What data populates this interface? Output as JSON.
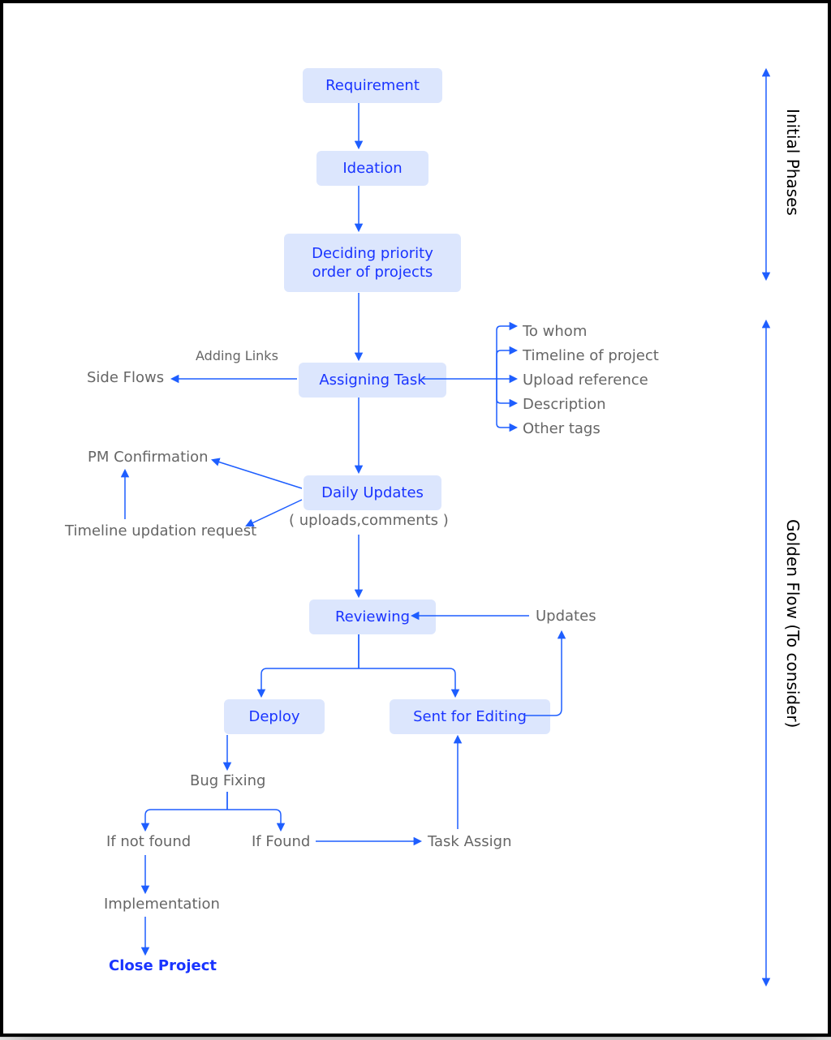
{
  "colors": {
    "box_bg": "#DCE6FD",
    "box_text": "#1934FF",
    "line": "#1E5EFF",
    "plain_text": "#666666",
    "bold_blue": "#1934FF"
  },
  "brackets": {
    "initial": "Initial Phases",
    "golden": "Golden Flow (To consider)"
  },
  "boxes": {
    "requirement": "Requirement",
    "ideation": "Ideation",
    "priority": "Deciding priority order of projects",
    "assigning": "Assigning Task",
    "daily": "Daily Updates",
    "reviewing": "Reviewing",
    "deploy": "Deploy",
    "editing": "Sent for Editing"
  },
  "plain": {
    "adding_links": "Adding Links",
    "side_flows": "Side Flows",
    "to_whom": "To whom",
    "timeline_project": "Timeline of project",
    "upload_ref": "Upload reference",
    "description": "Description",
    "other_tags": "Other tags",
    "pm_confirmation": "PM Confirmation",
    "timeline_updation": "Timeline updation request",
    "daily_sub": "( uploads,comments )",
    "updates": "Updates",
    "bug_fixing": "Bug Fixing",
    "if_not_found": "If not found",
    "if_found": "If Found",
    "task_assign": "Task Assign",
    "implementation": "Implementation"
  },
  "final": {
    "close_project": "Close Project"
  }
}
